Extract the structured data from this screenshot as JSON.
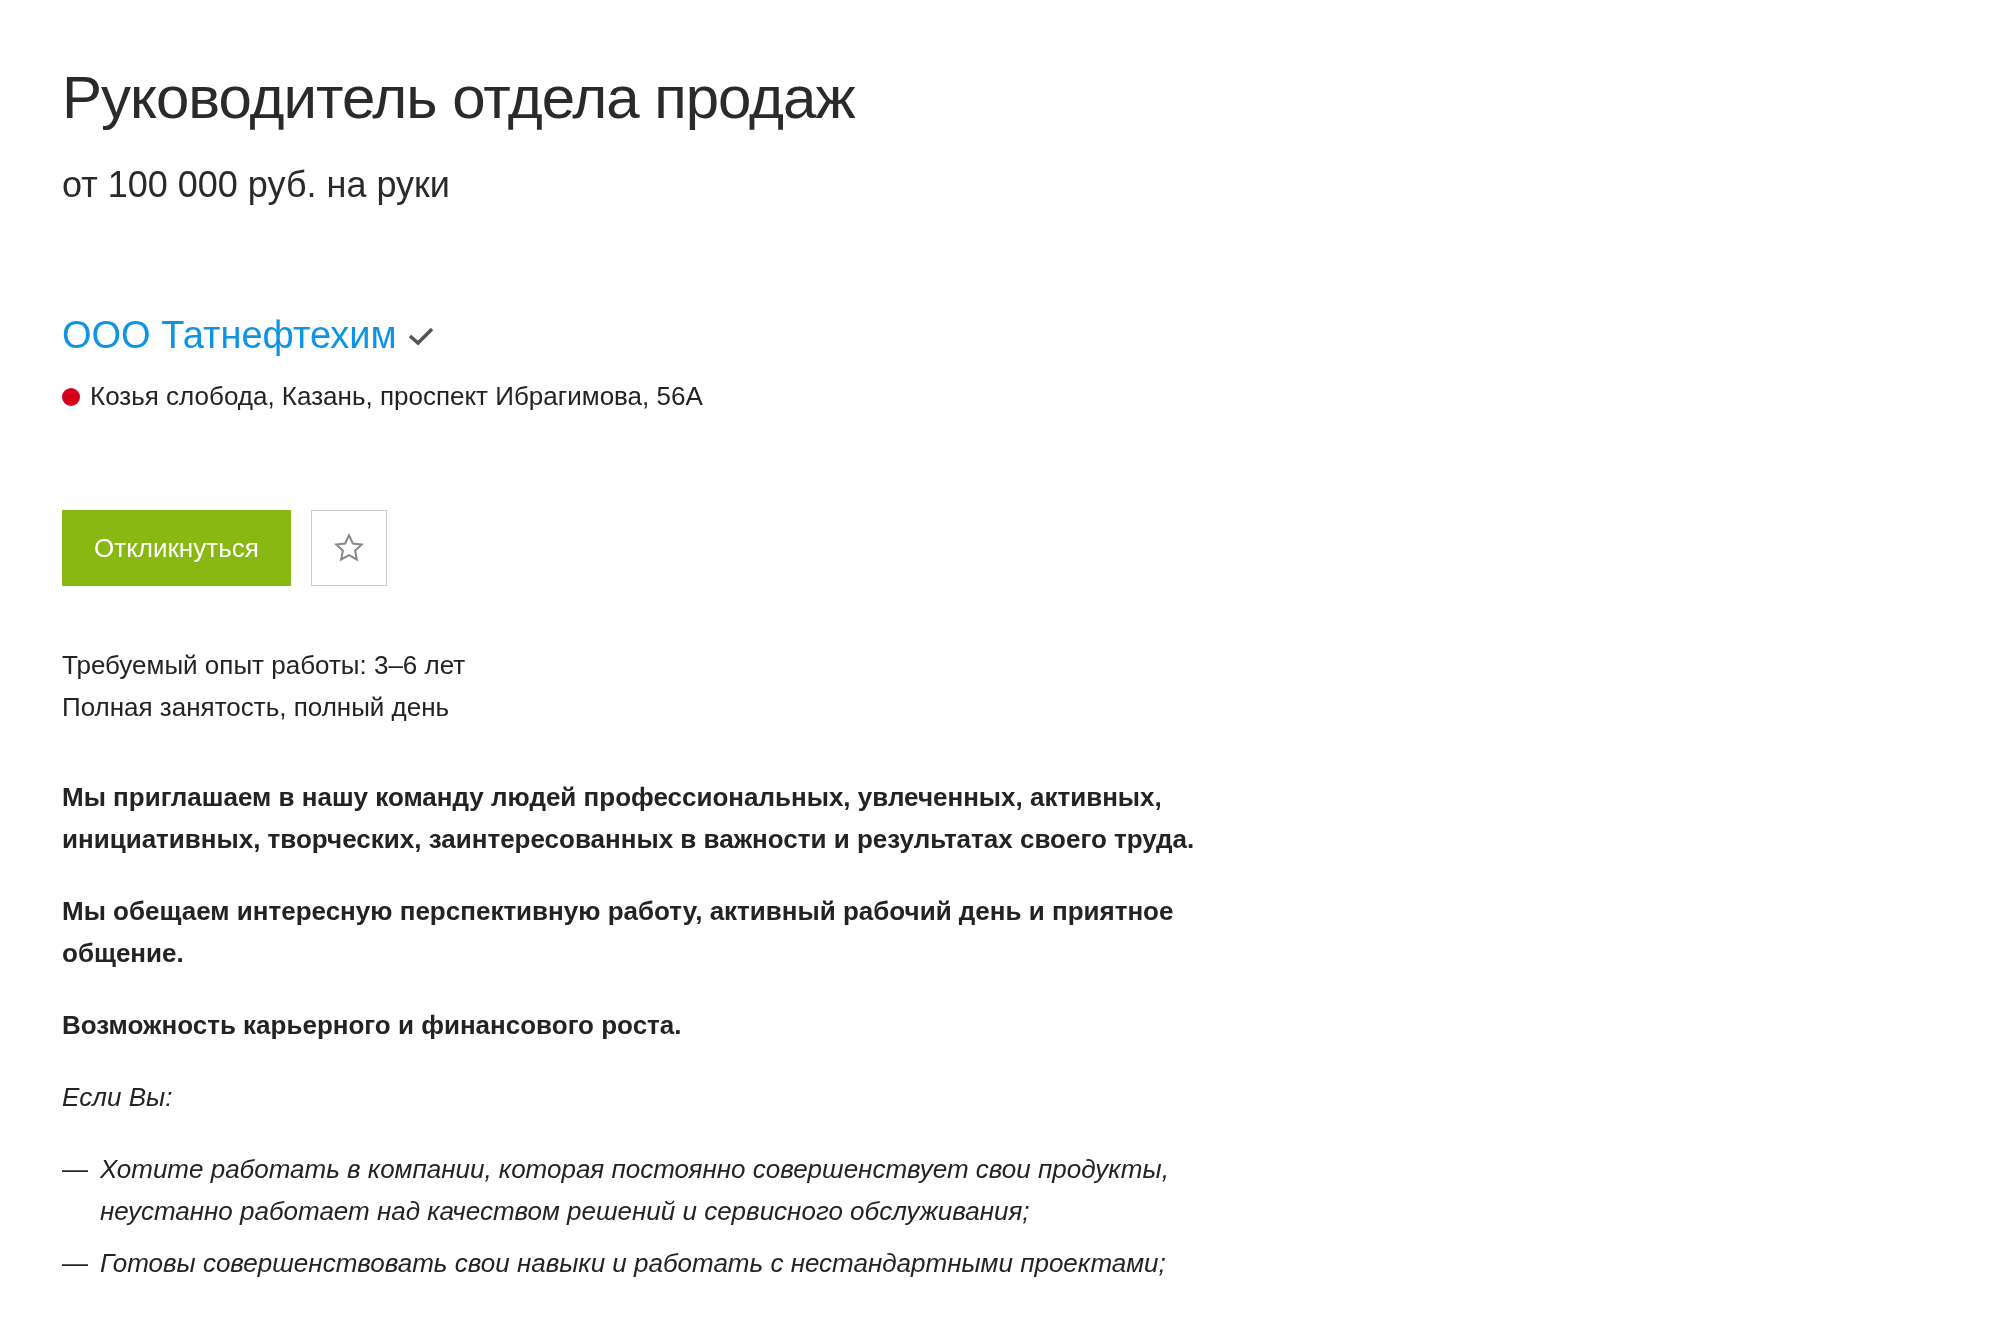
{
  "vacancy": {
    "title": "Руководитель отдела продаж",
    "salary": "от 100 000 руб. на руки"
  },
  "company": {
    "name": "ООО Татнефтехим",
    "verified": true
  },
  "location": {
    "color": "#d6001c",
    "address": "Козья слобода, Казань, проспект Ибрагимова, 56А"
  },
  "actions": {
    "respond_button": "Откликнуться",
    "favorite": false
  },
  "conditions": [
    "Требуемый опыт работы: 3–6 лет",
    "Полная занятость, полный день"
  ],
  "description": [
    {
      "kind": "bold",
      "text": "Мы приглашаем в нашу команду людей профессиональных, увлеченных, активных, инициативных, творческих, заинтересованных в важности и результатах своего труда."
    },
    {
      "kind": "bold",
      "text": "Мы обещаем интересную перспективную работу, активный рабочий день и приятное общение."
    },
    {
      "kind": "bold",
      "text": "Возможность карьерного и финансового роста."
    },
    {
      "kind": "italic",
      "text": "Если Вы:"
    },
    {
      "kind": "list",
      "items": [
        {
          "marker": "—",
          "text": "Хотите работать в компании, которая постоянно совершенствует свои продукты, неустанно работает над качеством решений и сервисного обслуживания;"
        },
        {
          "marker": "—",
          "text": "Готовы совершенствовать свои навыки и работать с нестандартными проектами;"
        }
      ]
    }
  ]
}
